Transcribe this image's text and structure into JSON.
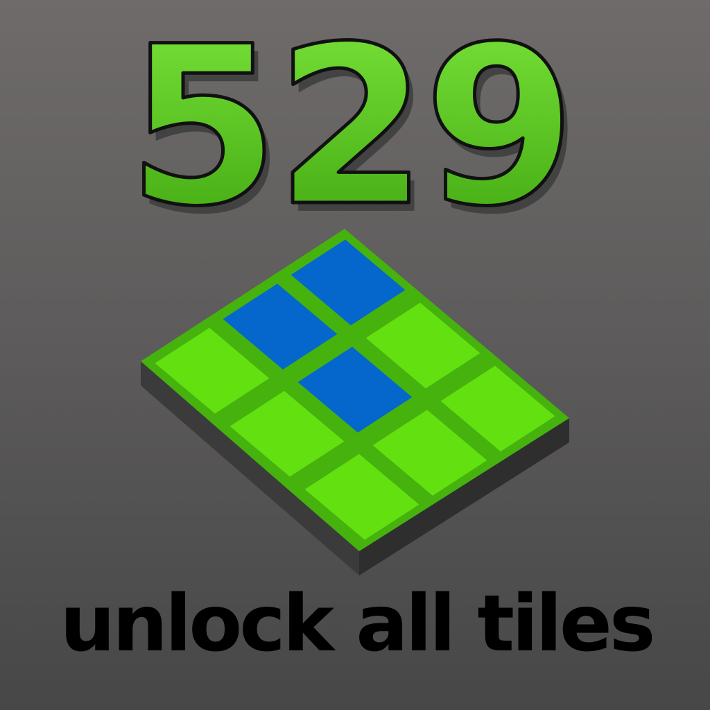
{
  "score": "529",
  "caption": "unlock all tiles",
  "grid": {
    "rows": 3,
    "cols": 3,
    "blue_tiles": [
      [
        0,
        0
      ],
      [
        1,
        0
      ],
      [
        1,
        1
      ]
    ],
    "tile_states": [
      [
        "blue",
        "green",
        "green"
      ],
      [
        "blue",
        "blue",
        "green"
      ],
      [
        "green",
        "green",
        "green"
      ]
    ]
  },
  "colors": {
    "score_fill_top": "#7be53a",
    "score_fill_bottom": "#3fa510",
    "score_outline": "#111111",
    "board_frame": "#46b20e",
    "board_side": "#3b3b3b",
    "tile_green": "#62e010",
    "tile_blue": "#0567cc",
    "caption": "#000000"
  }
}
